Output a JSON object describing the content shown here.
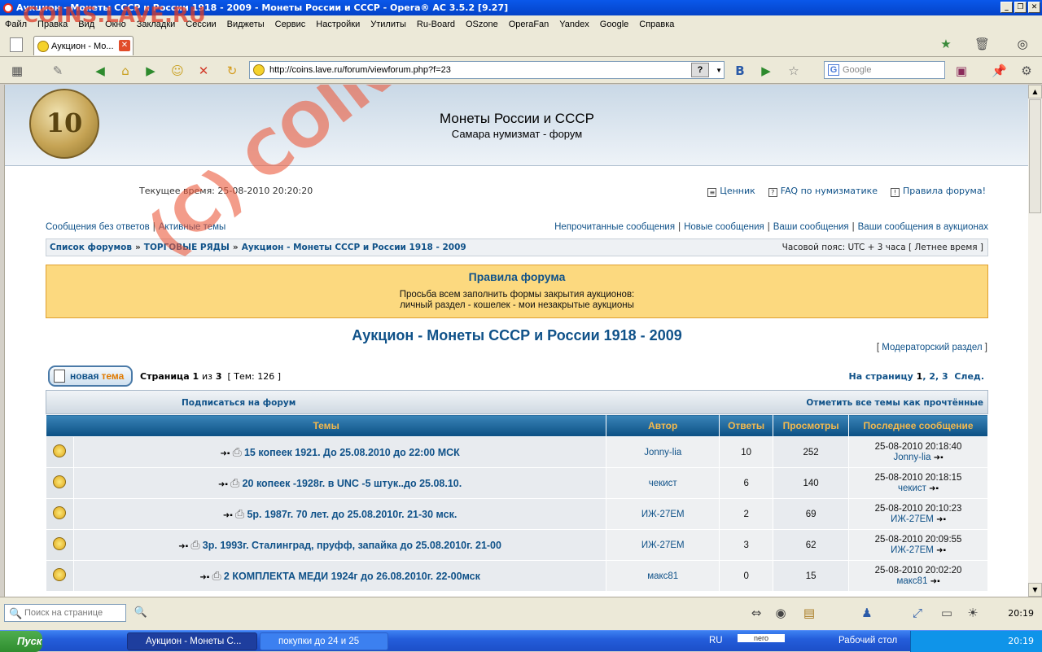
{
  "window": {
    "title": "Аукцион - Монеты СССР и России 1918 - 2009 - Монеты России и СССР - Opera® AC 3.5.2 [9.27]"
  },
  "menu": [
    "Файл",
    "Правка",
    "Вид",
    "Окно",
    "Закладки",
    "Сессии",
    "Виджеты",
    "Сервис",
    "Настройки",
    "Утилиты",
    "Ru-Board",
    "OSzone",
    "OperaFan",
    "Yandex",
    "Google",
    "Справка"
  ],
  "tab": {
    "label": "Аукцион - Мо..."
  },
  "address": {
    "url": "http://coins.lave.ru/forum/viewforum.php?f=23"
  },
  "search": {
    "placeholder": "Google"
  },
  "site": {
    "title": "Монеты России и СССР",
    "subtitle": "Самара нумизмат - форум",
    "coin_value": "10"
  },
  "toplinks": {
    "time": "Текущее время: 25-08-2010 20:20:20",
    "price": "Ценник",
    "faq": "FAQ по нумизматике",
    "rules": "Правила форума!"
  },
  "nav": {
    "left": [
      "Сообщения без ответов",
      "Активные темы"
    ],
    "right": [
      "Непрочитанные сообщения",
      "Новые сообщения",
      "Ваши сообщения",
      "Ваши сообщения в аукционах"
    ]
  },
  "breadcrumb": {
    "items": [
      "Список форумов",
      "ТОРГОВЫЕ РЯДЫ",
      "Аукцион - Монеты СССР и России 1918 - 2009"
    ],
    "sep": "»",
    "timezone": "Часовой пояс: UTC + 3 часа [ Летнее время ]"
  },
  "rules_box": {
    "title": "Правила форума",
    "line1": "Просьба всем заполнить формы закрытия аукционов:",
    "line2": "личный раздел - кошелек - мои незакрытые аукционы"
  },
  "forum": {
    "title": "Аукцион - Монеты СССР и России 1918 - 2009",
    "moderator": "Модераторский раздел"
  },
  "actions": {
    "new_topic_a": "новая",
    "new_topic_b": "тема",
    "page_label": "Страница",
    "page_cur": "1",
    "page_of": "из",
    "page_total": "3",
    "topics_count": "[ Тем: 126 ]",
    "goto_label": "На страницу",
    "pages": [
      "1",
      "2",
      "3"
    ],
    "next": "След.",
    "subscribe": "Подписаться на форум",
    "mark_read": "Отметить все темы как прочтённые"
  },
  "table": {
    "headers": [
      "Темы",
      "Автор",
      "Ответы",
      "Просмотры",
      "Последнее сообщение"
    ],
    "rows": [
      {
        "title": "15 копеек 1921. До 25.08.2010 до 22:00 МСК",
        "author": "Jonny-lia",
        "replies": "10",
        "views": "252",
        "last_time": "25-08-2010 20:18:40",
        "last_author": "Jonny-lia"
      },
      {
        "title": "20 копеек -1928г. в UNC -5 штук..до 25.08.10.",
        "author": "чекист",
        "replies": "6",
        "views": "140",
        "last_time": "25-08-2010 20:18:15",
        "last_author": "чекист"
      },
      {
        "title": "5р. 1987г. 70 лет. до 25.08.2010г. 21-30 мск.",
        "author": "ИЖ-27ЕМ",
        "replies": "2",
        "views": "69",
        "last_time": "25-08-2010 20:10:23",
        "last_author": "ИЖ-27ЕМ"
      },
      {
        "title": "3р. 1993г. Сталинград, пруфф, запайка до 25.08.2010г. 21-00",
        "author": "ИЖ-27ЕМ",
        "replies": "3",
        "views": "62",
        "last_time": "25-08-2010 20:09:55",
        "last_author": "ИЖ-27ЕМ"
      },
      {
        "title": "2 КОМПЛЕКТА МЕДИ 1924г до 26.08.2010г. 22-00мск",
        "author": "макс81",
        "replies": "0",
        "views": "15",
        "last_time": "25-08-2010 20:02:20",
        "last_author": "макс81"
      }
    ]
  },
  "watermarks": {
    "top": "COINS.LAVE.RU",
    "diag1": "(C) COINS.LAVE.RU"
  },
  "statusbar": {
    "find_placeholder": "Поиск на странице",
    "clock": "20:19"
  },
  "taskbar": {
    "start": "Пуск",
    "tasks": [
      "Аукцион - Монеты С...",
      "покупки до 24 и 25"
    ],
    "lang": "RU",
    "desktop": "Рабочий стол",
    "clock": "20:19",
    "nero": "nero"
  }
}
